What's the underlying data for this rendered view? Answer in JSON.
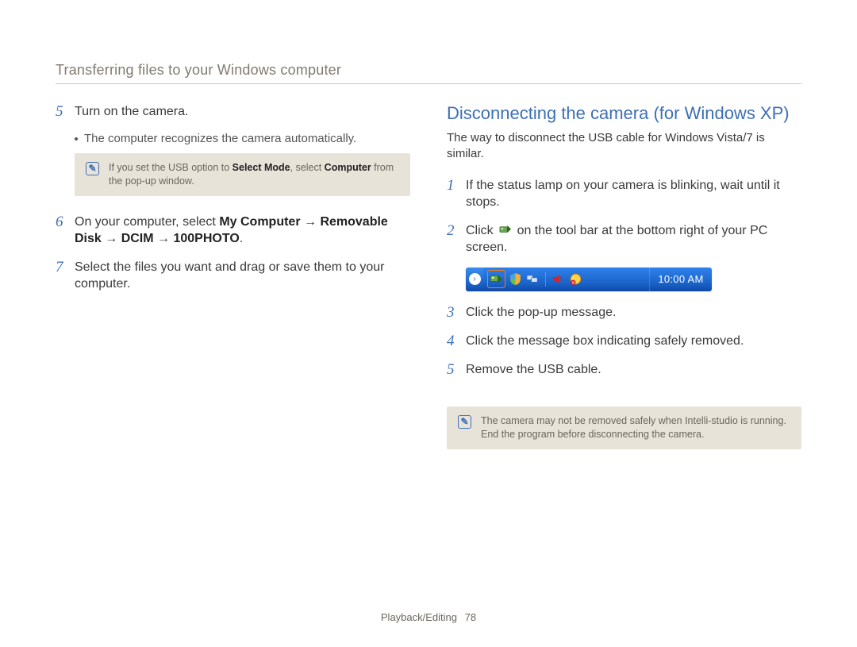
{
  "header": {
    "title": "Transferring files to your Windows computer"
  },
  "left": {
    "step5": {
      "num": "5",
      "text": "Turn on the camera.",
      "bullet": "The computer recognizes the camera automatically."
    },
    "note1": {
      "parts": [
        "If you set the USB option to ",
        "Select Mode",
        ", select ",
        "Computer",
        " from the pop-up window."
      ]
    },
    "step6": {
      "num": "6",
      "parts": [
        "On your computer, select ",
        "My Computer",
        " → ",
        "Removable Disk",
        " → ",
        "DCIM",
        " → ",
        "100PHOTO",
        "."
      ]
    },
    "step7": {
      "num": "7",
      "text": "Select the files you want and drag or save them to your computer."
    }
  },
  "right": {
    "section_title": "Disconnecting the camera (for Windows XP)",
    "section_sub": "The way to disconnect the USB cable for Windows Vista/7 is similar.",
    "step1": {
      "num": "1",
      "text": "If the status lamp on your camera is blinking, wait until it stops."
    },
    "step2": {
      "num": "2",
      "pre": "Click ",
      "post": " on the tool bar at the bottom right of your PC screen."
    },
    "taskbar": {
      "clock": "10:00 AM"
    },
    "step3": {
      "num": "3",
      "text": "Click the pop-up message."
    },
    "step4": {
      "num": "4",
      "text": "Click the message box indicating safely removed."
    },
    "step5": {
      "num": "5",
      "text": "Remove the USB cable."
    },
    "note2": {
      "line1": "The camera may not be removed safely when Intelli-studio is running.",
      "line2": "End the program before disconnecting the camera."
    }
  },
  "footer": {
    "section": "Playback/Editing",
    "page": "78"
  }
}
